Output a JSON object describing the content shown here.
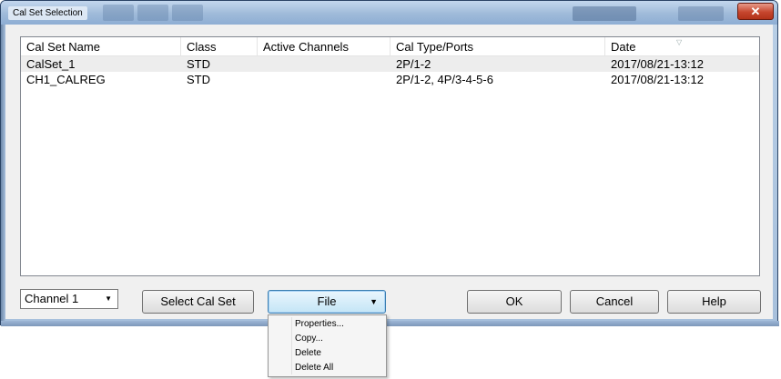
{
  "window": {
    "title": "Cal Set Selection",
    "close_glyph": "✕"
  },
  "list": {
    "columns": [
      "Cal Set Name",
      "Class",
      "Active Channels",
      "Cal Type/Ports",
      "Date"
    ],
    "rows": [
      {
        "name": "CalSet_1",
        "class": "STD",
        "active_channels": "",
        "cal_type_ports": "2P/1-2",
        "date": "2017/08/21-13:12"
      },
      {
        "name": "CH1_CALREG",
        "class": "STD",
        "active_channels": "",
        "cal_type_ports": "2P/1-2, 4P/3-4-5-6",
        "date": "2017/08/21-13:12"
      }
    ]
  },
  "controls": {
    "channel_select_value": "Channel 1",
    "select_cal_set_label": "Select Cal Set",
    "file_label": "File",
    "ok_label": "OK",
    "cancel_label": "Cancel",
    "help_label": "Help"
  },
  "file_menu": {
    "items": [
      "Properties...",
      "Copy...",
      "Delete",
      "Delete All"
    ]
  },
  "colors": {
    "title_bar": "#9fbad9",
    "close_button": "#c6462e",
    "selected_row": "#ededed",
    "focus_button": "#c4e5f6"
  }
}
